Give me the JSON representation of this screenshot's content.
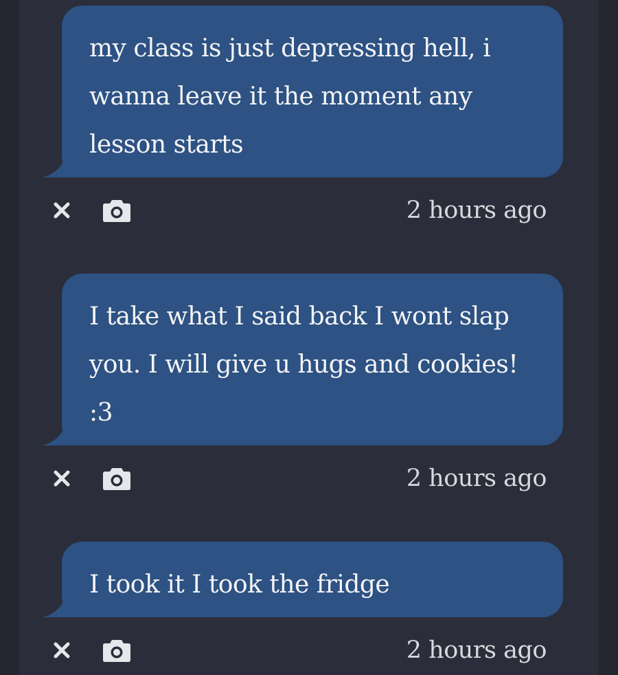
{
  "messages": [
    {
      "text": "my class is just depressing hell, i wanna leave it the moment any lesson starts",
      "time": "2 hours ago"
    },
    {
      "text": "I take what I said back I wont slap you. I will give u hugs and cookies! :3",
      "time": "2 hours ago"
    },
    {
      "text": "I took it I took the fridge",
      "time": "2 hours ago"
    }
  ],
  "icons": {
    "delete": "close-icon",
    "photo": "camera-icon"
  },
  "colors": {
    "background": "#24262f",
    "feed": "#2b2e3a",
    "bubble": "#2d5283",
    "text": "#f4f4f6",
    "meta": "#d8d9de"
  }
}
